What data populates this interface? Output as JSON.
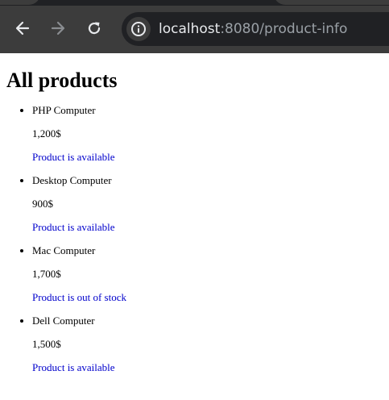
{
  "browser": {
    "url_host": "localhost",
    "url_path": ":8080/product-info"
  },
  "page": {
    "title": "All products",
    "products": [
      {
        "name": "PHP Computer",
        "price": "1,200$",
        "status": "Product is available"
      },
      {
        "name": "Desktop Computer",
        "price": "900$",
        "status": "Product is available"
      },
      {
        "name": "Mac Computer",
        "price": "1,700$",
        "status": "Product is out of stock"
      },
      {
        "name": "Dell Computer",
        "price": "1,500$",
        "status": "Product is available"
      }
    ]
  },
  "colors": {
    "chrome_background": "#3c3c3c",
    "omnibox_background": "#202124",
    "status_text": "#0000cc"
  }
}
